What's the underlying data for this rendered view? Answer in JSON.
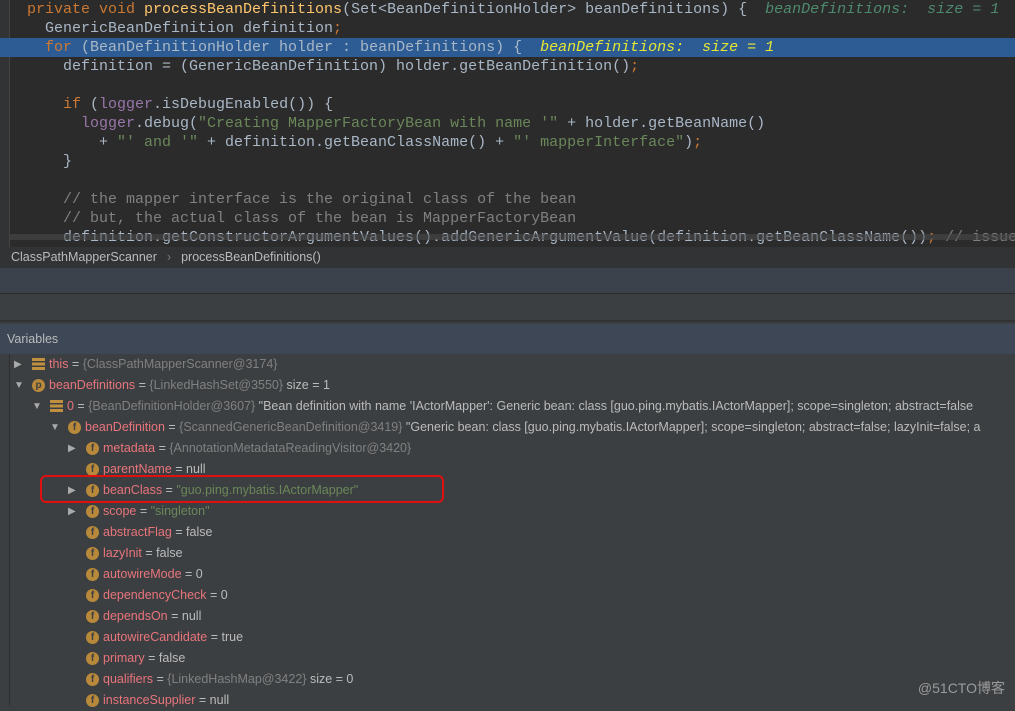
{
  "code": [
    {
      "hl": false,
      "ind": 27,
      "t": [
        [
          "private void ",
          "kw"
        ],
        [
          "processBeanDefinitions",
          "fn"
        ],
        [
          "(Set<BeanDefinitionHolder> beanDefinitions) {",
          ""
        ],
        [
          "  beanDefinitions:  size = 1",
          "hint"
        ]
      ]
    },
    {
      "hl": false,
      "ind": 45,
      "t": [
        [
          "GenericBeanDefinition definition",
          ""
        ],
        [
          ";",
          "semi"
        ]
      ]
    },
    {
      "hl": true,
      "ind": 45,
      "t": [
        [
          "for ",
          "kw"
        ],
        [
          "(BeanDefinitionHolder holder : beanDefinitions) {",
          ""
        ],
        [
          "  beanDefinitions:  size = 1",
          "hint"
        ]
      ]
    },
    {
      "hl": false,
      "ind": 63,
      "t": [
        [
          "definition = (GenericBeanDefinition) holder.getBeanDefinition()",
          ""
        ],
        [
          ";",
          "semi"
        ]
      ]
    },
    {
      "hl": false,
      "ind": 63,
      "t": []
    },
    {
      "hl": false,
      "ind": 63,
      "t": [
        [
          "if ",
          "kw"
        ],
        [
          "(",
          ""
        ],
        [
          "logger",
          "fld"
        ],
        [
          ".isDebugEnabled()) {",
          ""
        ]
      ]
    },
    {
      "hl": false,
      "ind": 81,
      "t": [
        [
          "logger",
          "fld"
        ],
        [
          ".debug(",
          ""
        ],
        [
          "\"Creating MapperFactoryBean with name '\"",
          "str"
        ],
        [
          " + holder.getBeanName()",
          ""
        ]
      ]
    },
    {
      "hl": false,
      "ind": 99,
      "t": [
        [
          "+ ",
          ""
        ],
        [
          "\"' and '\"",
          "str"
        ],
        [
          " + definition.getBeanClassName() + ",
          ""
        ],
        [
          "\"' mapperInterface\"",
          "str"
        ],
        [
          ")",
          ""
        ],
        [
          ";",
          "semi"
        ]
      ]
    },
    {
      "hl": false,
      "ind": 63,
      "t": [
        [
          "}",
          ""
        ]
      ]
    },
    {
      "hl": false,
      "ind": 63,
      "t": []
    },
    {
      "hl": false,
      "ind": 63,
      "t": [
        [
          "// the mapper interface is the original class of the bean",
          "cm"
        ]
      ]
    },
    {
      "hl": false,
      "ind": 63,
      "t": [
        [
          "// but, the actual class of the bean is MapperFactoryBean",
          "cm"
        ]
      ]
    },
    {
      "hl": false,
      "ind": 63,
      "t": [
        [
          "definition.getConstructorArgumentValues().addGenericArgumentValue(definition.getBeanClassName())",
          ""
        ],
        [
          "; ",
          "semi"
        ],
        [
          "// issue",
          "cm"
        ]
      ]
    }
  ],
  "breadcrumb": [
    "ClassPathMapperScanner",
    "processBeanDefinitions()"
  ],
  "variables": {
    "title": "Variables",
    "rows": [
      {
        "lvl": 0,
        "arrow": "right",
        "icon": "lines",
        "name": "this",
        "eq": " = ",
        "ref": "{ClassPathMapperScanner@3174}",
        "rest": "",
        "val": ""
      },
      {
        "lvl": 0,
        "arrow": "down",
        "icon": "p",
        "name": "beanDefinitions",
        "eq": " = ",
        "ref": "{LinkedHashSet@3550}",
        "rest": "  size = 1",
        "val": ""
      },
      {
        "lvl": 1,
        "arrow": "down",
        "icon": "lines",
        "name": "0",
        "eq": " = ",
        "ref": "{BeanDefinitionHolder@3607}",
        "rest": " \"Bean definition with name 'IActorMapper': Generic bean: class [guo.ping.mybatis.IActorMapper]; scope=singleton; abstract=false",
        "val": ""
      },
      {
        "lvl": 2,
        "arrow": "down",
        "icon": "f",
        "name": "beanDefinition",
        "eq": " = ",
        "ref": "{ScannedGenericBeanDefinition@3419}",
        "rest": " \"Generic bean: class [guo.ping.mybatis.IActorMapper]; scope=singleton; abstract=false; lazyInit=false; a",
        "val": ""
      },
      {
        "lvl": 3,
        "arrow": "right",
        "icon": "f",
        "name": "metadata",
        "eq": " = ",
        "ref": "{AnnotationMetadataReadingVisitor@3420}",
        "rest": "",
        "val": ""
      },
      {
        "lvl": 3,
        "arrow": "",
        "icon": "f",
        "name": "parentName",
        "eq": " = ",
        "ref": "",
        "rest": "null",
        "val": ""
      },
      {
        "lvl": 3,
        "arrow": "right",
        "icon": "f",
        "name": "beanClass",
        "eq": " = ",
        "ref": "",
        "rest": "",
        "val": "\"guo.ping.mybatis.IActorMapper\""
      },
      {
        "lvl": 3,
        "arrow": "right",
        "icon": "f",
        "name": "scope",
        "eq": " = ",
        "ref": "",
        "rest": "",
        "val": "\"singleton\""
      },
      {
        "lvl": 3,
        "arrow": "",
        "icon": "f",
        "name": "abstractFlag",
        "eq": " = ",
        "ref": "",
        "rest": "false",
        "val": ""
      },
      {
        "lvl": 3,
        "arrow": "",
        "icon": "f",
        "name": "lazyInit",
        "eq": " = ",
        "ref": "",
        "rest": "false",
        "val": ""
      },
      {
        "lvl": 3,
        "arrow": "",
        "icon": "f",
        "name": "autowireMode",
        "eq": " = ",
        "ref": "",
        "rest": "0",
        "val": ""
      },
      {
        "lvl": 3,
        "arrow": "",
        "icon": "f",
        "name": "dependencyCheck",
        "eq": " = ",
        "ref": "",
        "rest": "0",
        "val": ""
      },
      {
        "lvl": 3,
        "arrow": "",
        "icon": "f",
        "name": "dependsOn",
        "eq": " = ",
        "ref": "",
        "rest": "null",
        "val": ""
      },
      {
        "lvl": 3,
        "arrow": "",
        "icon": "f",
        "name": "autowireCandidate",
        "eq": " = ",
        "ref": "",
        "rest": "true",
        "val": ""
      },
      {
        "lvl": 3,
        "arrow": "",
        "icon": "f",
        "name": "primary",
        "eq": " = ",
        "ref": "",
        "rest": "false",
        "val": ""
      },
      {
        "lvl": 3,
        "arrow": "",
        "icon": "f",
        "name": "qualifiers",
        "eq": " = ",
        "ref": "{LinkedHashMap@3422}",
        "rest": "  size = 0",
        "val": ""
      },
      {
        "lvl": 3,
        "arrow": "",
        "icon": "f",
        "name": "instanceSupplier",
        "eq": " = ",
        "ref": "",
        "rest": "null",
        "val": ""
      }
    ]
  },
  "highlight_color": "#e01010",
  "watermark": "@51CTO博客"
}
